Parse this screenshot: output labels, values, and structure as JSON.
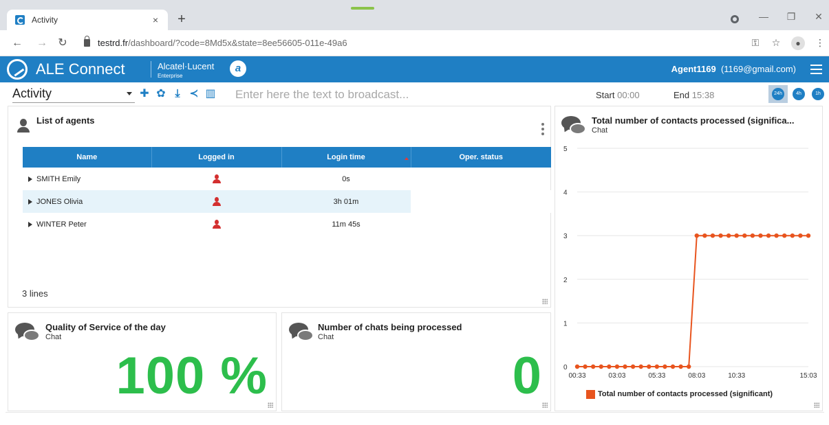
{
  "browser": {
    "tab_title": "Activity",
    "tab_close": "×",
    "new_tab": "+",
    "url_domain": "testrd.fr",
    "url_path": "/dashboard/?code=8Md5x&state=8ee56605-011e-49a6"
  },
  "app": {
    "name": "ALE Connect",
    "brand": "Alcatel·Lucent",
    "brand_sub": "Enterprise",
    "brand_mark": "a",
    "agent_name": "Agent1169",
    "agent_email": "(1169@gmail.com)"
  },
  "toolbar": {
    "dashboard": "Activity",
    "broadcast_placeholder": "Enter here the text to broadcast...",
    "start_label": "Start",
    "start_value": "00:00",
    "end_label": "End",
    "end_value": "15:38",
    "periods": [
      "24h",
      "4h",
      "1h"
    ],
    "active_period": "24h"
  },
  "agents_widget": {
    "title": "List of agents",
    "columns": [
      "Name",
      "Logged in",
      "Login time",
      "Oper. status"
    ],
    "rows": [
      {
        "name": "SMITH Emily",
        "login_time": "0s",
        "oper_status": ""
      },
      {
        "name": "JONES Olivia",
        "login_time": "3h 01m",
        "oper_status": ""
      },
      {
        "name": "WINTER Peter",
        "login_time": "11m 45s",
        "oper_status": ""
      }
    ],
    "footer": "3 lines"
  },
  "qos_widget": {
    "title": "Quality of Service of the day",
    "subtitle": "Chat",
    "value": "100 %"
  },
  "chats_widget": {
    "title": "Number of chats being processed",
    "subtitle": "Chat",
    "value": "0"
  },
  "contacts_widget": {
    "title": "Total number of contacts processed (significa...",
    "subtitle": "Chat"
  },
  "colors": {
    "brand": "#1f7fc4",
    "value_green": "#2dbe4c",
    "series": "#e8541e",
    "logged_in": "#d32f2f"
  },
  "chart_data": {
    "type": "line",
    "title": "",
    "xlabel": "",
    "ylabel": "",
    "x_ticks": [
      "00:33",
      "03:03",
      "05:33",
      "08:03",
      "10:33",
      "15:03"
    ],
    "y_ticks": [
      0,
      1,
      2,
      3,
      4,
      5
    ],
    "ylim": [
      0,
      5
    ],
    "xlim": [
      "00:33",
      "15:03"
    ],
    "grid": "horizontal",
    "legend_placement": "bottom",
    "series": [
      {
        "name": "Total number of contacts processed (significant)",
        "color": "#e8541e",
        "x": [
          "00:33",
          "01:03",
          "01:33",
          "02:03",
          "02:33",
          "03:03",
          "03:33",
          "04:03",
          "04:33",
          "05:03",
          "05:33",
          "06:03",
          "06:33",
          "07:03",
          "07:33",
          "08:03",
          "08:33",
          "09:03",
          "09:33",
          "10:03",
          "10:33",
          "11:03",
          "11:33",
          "12:03",
          "12:33",
          "13:03",
          "13:33",
          "14:03",
          "14:33",
          "15:03"
        ],
        "values": [
          0,
          0,
          0,
          0,
          0,
          0,
          0,
          0,
          0,
          0,
          0,
          0,
          0,
          0,
          0,
          3,
          3,
          3,
          3,
          3,
          3,
          3,
          3,
          3,
          3,
          3,
          3,
          3,
          3,
          3
        ]
      }
    ]
  }
}
